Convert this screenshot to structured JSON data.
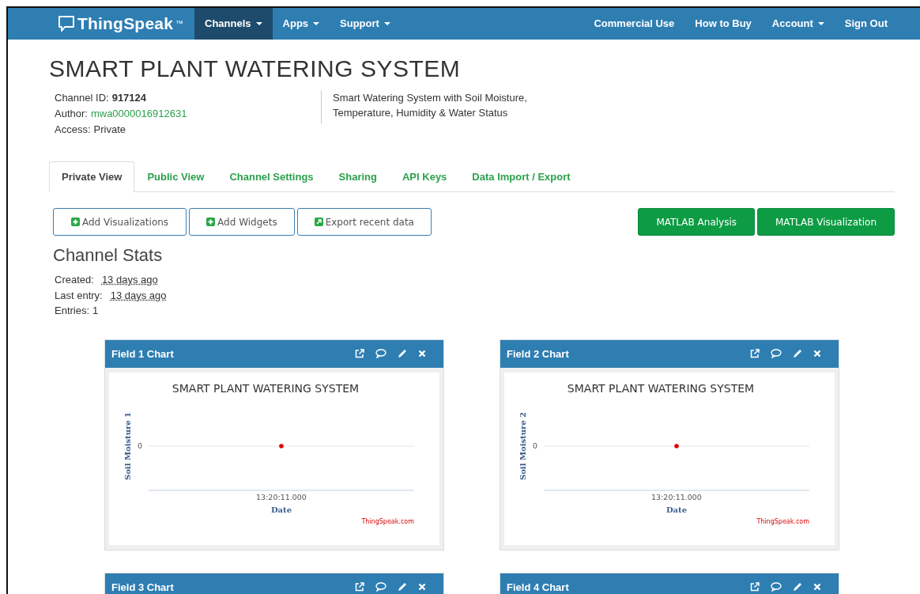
{
  "nav": {
    "logo": "ThingSpeak",
    "trademark": "™",
    "left_items": [
      {
        "label": "Channels",
        "dropdown": true,
        "selected": true
      },
      {
        "label": "Apps",
        "dropdown": true,
        "selected": false
      },
      {
        "label": "Support",
        "dropdown": true,
        "selected": false
      }
    ],
    "right_items": [
      {
        "label": "Commercial Use",
        "dropdown": false
      },
      {
        "label": "How to Buy",
        "dropdown": false
      },
      {
        "label": "Account",
        "dropdown": true
      },
      {
        "label": "Sign Out",
        "dropdown": false
      }
    ]
  },
  "channel": {
    "title": "SMART PLANT WATERING SYSTEM",
    "meta": [
      {
        "label": "Channel ID:",
        "value": "917124",
        "kind": "bold"
      },
      {
        "label": "Author:",
        "value": "mwa0000016912631",
        "kind": "link"
      },
      {
        "label": "Access:",
        "value": "Private",
        "kind": "plain"
      }
    ],
    "description": "Smart Watering System with Soil Moisture, Temperature, Humidity & Water Status"
  },
  "tabs": [
    {
      "label": "Private View",
      "selected": true
    },
    {
      "label": "Public View",
      "selected": false
    },
    {
      "label": "Channel Settings",
      "selected": false
    },
    {
      "label": "Sharing",
      "selected": false
    },
    {
      "label": "API Keys",
      "selected": false
    },
    {
      "label": "Data Import / Export",
      "selected": false
    }
  ],
  "action_buttons": [
    {
      "label": "Add Visualizations",
      "kind": "add"
    },
    {
      "label": "Add Widgets",
      "kind": "add"
    },
    {
      "label": "Export recent data",
      "kind": "export"
    }
  ],
  "matlab_buttons": [
    {
      "label": "MATLAB Analysis"
    },
    {
      "label": "MATLAB Visualization"
    }
  ],
  "stats": {
    "heading": "Channel Stats",
    "items": [
      {
        "label": "Created:",
        "value": "13 days ago",
        "kind": "time"
      },
      {
        "label": "Last entry:",
        "value": "13 days ago",
        "kind": "time"
      },
      {
        "label": "Entries:",
        "value": "1",
        "kind": "plain"
      }
    ]
  },
  "charts": [
    {
      "title": "Field 1 Chart",
      "plot": {
        "title": "SMART PLANT WATERING SYSTEM",
        "y_label": "Soil Moisture 1",
        "y_tick": "0",
        "x_tick": "13:20:11.000",
        "x_label": "Date",
        "credit": "ThingSpeak.com"
      }
    },
    {
      "title": "Field 2 Chart",
      "plot": {
        "title": "SMART PLANT WATERING SYSTEM",
        "y_label": "Soil Moisture 2",
        "y_tick": "0",
        "x_tick": "13:20:11.000",
        "x_label": "Date",
        "credit": "ThingSpeak.com"
      }
    },
    {
      "title": "Field 3 Chart"
    },
    {
      "title": "Field 4 Chart"
    }
  ]
}
